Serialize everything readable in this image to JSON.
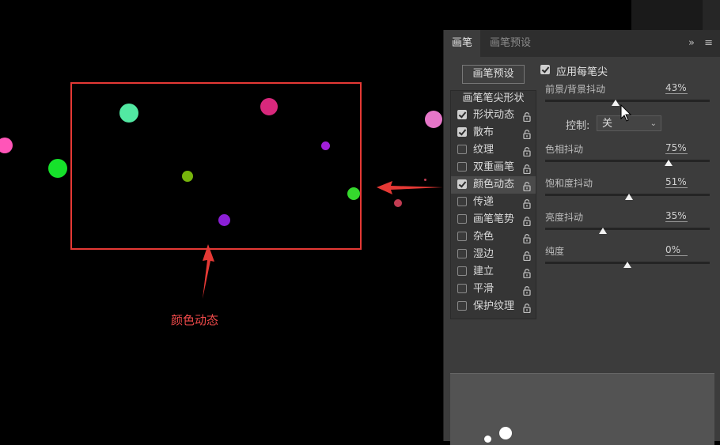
{
  "annotation": {
    "label": "颜色动态"
  },
  "colors": {
    "accent_red": "#e53935",
    "panel_bg": "#3c3c3c"
  },
  "panel": {
    "tabs": [
      {
        "label": "画笔"
      },
      {
        "label": "画笔预设"
      }
    ],
    "tab_icons": {
      "expand": "»",
      "menu": "≡"
    },
    "preset_button": "画笔预设",
    "list_header": "画笔笔尖形状",
    "items": [
      {
        "label": "形状动态",
        "checked": true
      },
      {
        "label": "散布",
        "checked": true
      },
      {
        "label": "纹理",
        "checked": false
      },
      {
        "label": "双重画笔",
        "checked": false
      },
      {
        "label": "颜色动态",
        "checked": true
      },
      {
        "label": "传递",
        "checked": false
      },
      {
        "label": "画笔笔势",
        "checked": false
      },
      {
        "label": "杂色",
        "checked": false
      },
      {
        "label": "湿边",
        "checked": false
      },
      {
        "label": "建立",
        "checked": false
      },
      {
        "label": "平滑",
        "checked": false
      },
      {
        "label": "保护纹理",
        "checked": false
      }
    ],
    "apply_per_tip": {
      "label": "应用每笔尖",
      "checked": true
    },
    "params": [
      {
        "label": "前景/背景抖动",
        "value": "43%",
        "pos": 0.43
      },
      {
        "label": "色相抖动",
        "value": "75%",
        "pos": 0.75
      },
      {
        "label": "饱和度抖动",
        "value": "51%",
        "pos": 0.51
      },
      {
        "label": "亮度抖动",
        "value": "35%",
        "pos": 0.35
      },
      {
        "label": "纯度",
        "value": "0%",
        "pos": 0.5
      }
    ],
    "control": {
      "label": "控制:",
      "value": "关"
    }
  }
}
